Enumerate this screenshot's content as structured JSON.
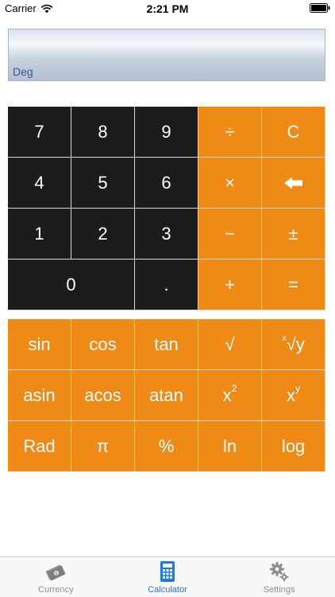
{
  "status_bar": {
    "carrier": "Carrier",
    "time": "2:21 PM",
    "wifi_icon": "wifi-icon",
    "battery_icon": "battery-full-icon"
  },
  "display": {
    "value": "",
    "mode": "Deg"
  },
  "keypad_main": [
    [
      "7",
      "8",
      "9",
      "÷",
      "C"
    ],
    [
      "4",
      "5",
      "6",
      "×",
      ""
    ],
    [
      "1",
      "2",
      "3",
      "−",
      "±"
    ],
    [
      "0",
      ".",
      "+",
      "="
    ]
  ],
  "keypad_sci": {
    "row1": [
      "sin",
      "cos",
      "tan",
      "√",
      "y"
    ],
    "row1_root_index": "x",
    "row2": [
      "asin",
      "acos",
      "atan",
      "x",
      "x"
    ],
    "row2_exponents": [
      "2",
      "y"
    ],
    "row3": [
      "Rad",
      "π",
      "%",
      "ln",
      "log"
    ]
  },
  "tabs": [
    {
      "label": "Currency",
      "icon": "currency-money-icon",
      "active": false
    },
    {
      "label": "Calculator",
      "icon": "calculator-icon",
      "active": true
    },
    {
      "label": "Settings",
      "icon": "gear-icon",
      "active": false
    }
  ],
  "colors": {
    "dark_key": "#1c1c1c",
    "orange_key": "#ef8a17",
    "tab_active": "#1a7be0",
    "tab_inactive": "#8e8e8e",
    "display_text": "#315a9a"
  }
}
